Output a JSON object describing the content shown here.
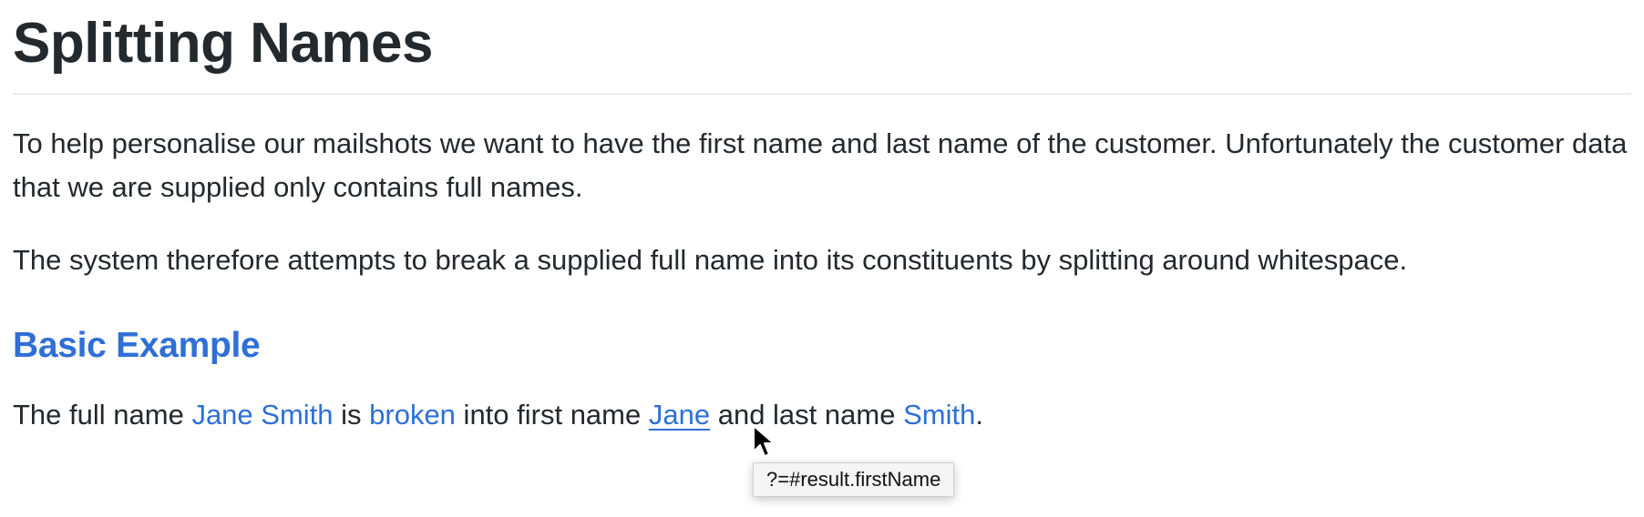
{
  "document": {
    "title": "Splitting Names",
    "intro_paragraph": "To help personalise our mailshots we want to have the first name and last name of the customer. Unfortunately the customer data that we are supplied only contains full names.",
    "system_paragraph": "The system therefore attempts to break a supplied full name into its constituents by splitting around whitespace.",
    "section_heading": "Basic Example",
    "example": {
      "text_1": "The full name ",
      "full_name": "Jane Smith",
      "text_2": " is ",
      "broken": "broken",
      "text_3": " into first name ",
      "first_name": "Jane",
      "text_4": " and last name ",
      "last_name": "Smith",
      "text_5": "."
    }
  },
  "tooltip": {
    "text": "?=#result.firstName"
  },
  "colors": {
    "text": "#24292e",
    "link": "#2f6fd6",
    "rule": "#eaecef"
  },
  "icons": {
    "cursor": "mouse-pointer-arrow-icon"
  }
}
